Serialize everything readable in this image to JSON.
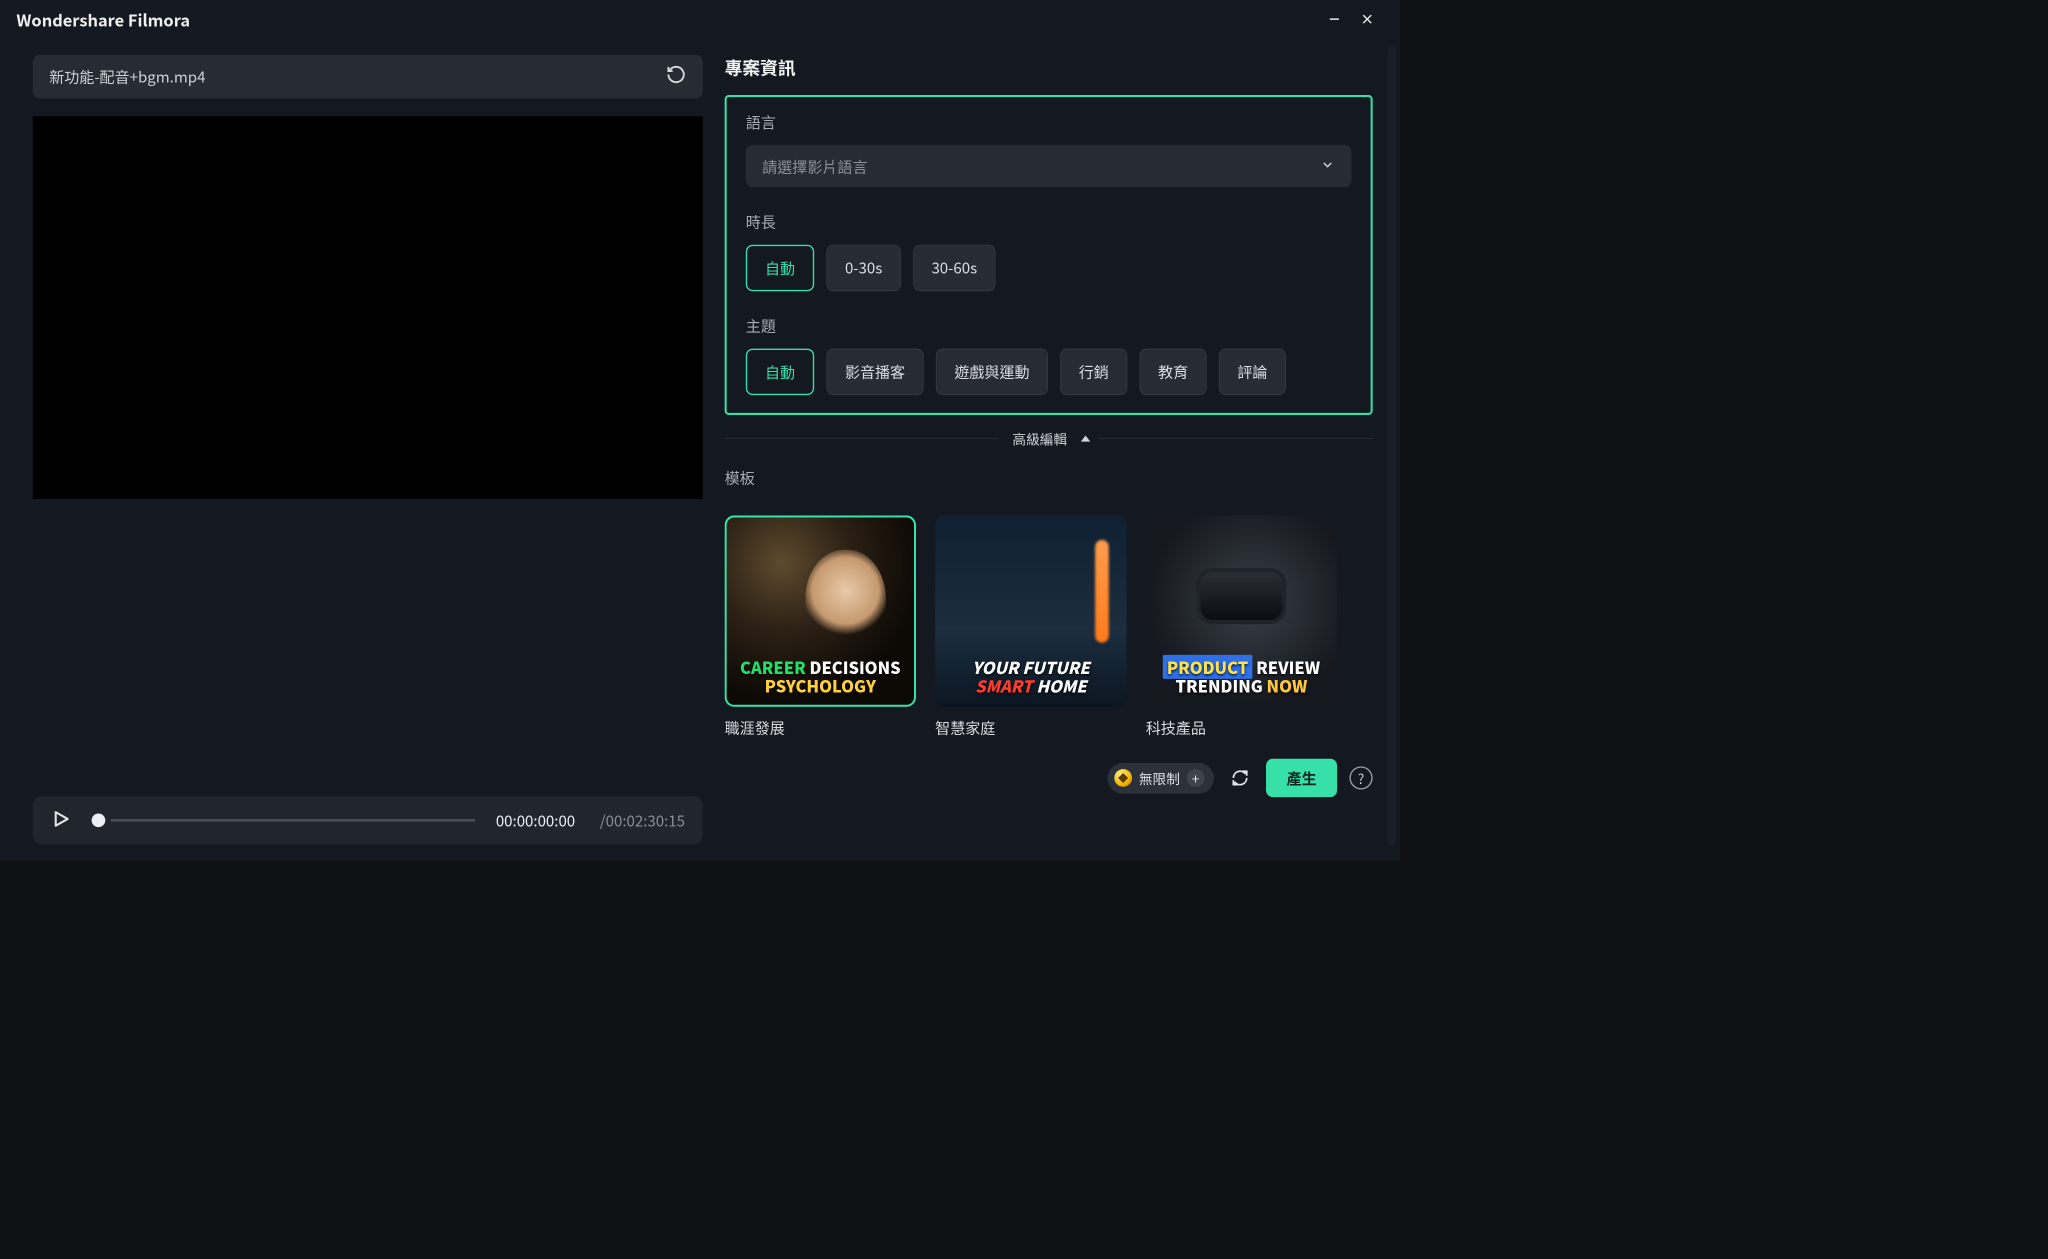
{
  "app": {
    "title": "Wondershare Filmora"
  },
  "file": {
    "name": "新功能-配音+bgm.mp4"
  },
  "playback": {
    "current": "00:00:00:00",
    "duration": "/00:02:30:15"
  },
  "panel": {
    "title": "專案資訊",
    "language": {
      "label": "語言",
      "placeholder": "請選擇影片語言"
    },
    "duration": {
      "label": "時長",
      "options": [
        "自動",
        "0-30s",
        "30-60s"
      ],
      "selected": 0
    },
    "topic": {
      "label": "主題",
      "options": [
        "自動",
        "影音播客",
        "遊戲與運動",
        "行銷",
        "教育",
        "評論"
      ],
      "selected": 0
    },
    "advanced_label": "高級編輯",
    "templates": {
      "label": "模板",
      "items": [
        {
          "caption": "職涯發展",
          "kind": "career",
          "overlay_line1_a": "CAREER",
          "overlay_line1_b": "DECISIONS",
          "overlay_line2": "PSYCHOLOGY",
          "selected": true
        },
        {
          "caption": "智慧家庭",
          "kind": "home",
          "overlay_line1": "YOUR FUTURE",
          "overlay_line2_a": "SMART",
          "overlay_line2_b": "HOME",
          "selected": false
        },
        {
          "caption": "科技產品",
          "kind": "tech",
          "overlay_line1_a": "PRODUCT",
          "overlay_line1_b": "REVIEW",
          "overlay_line2_a": "TRENDING",
          "overlay_line2_b": "NOW",
          "selected": false
        }
      ]
    }
  },
  "footer": {
    "unlimited_label": "無限制",
    "generate_label": "產生"
  }
}
